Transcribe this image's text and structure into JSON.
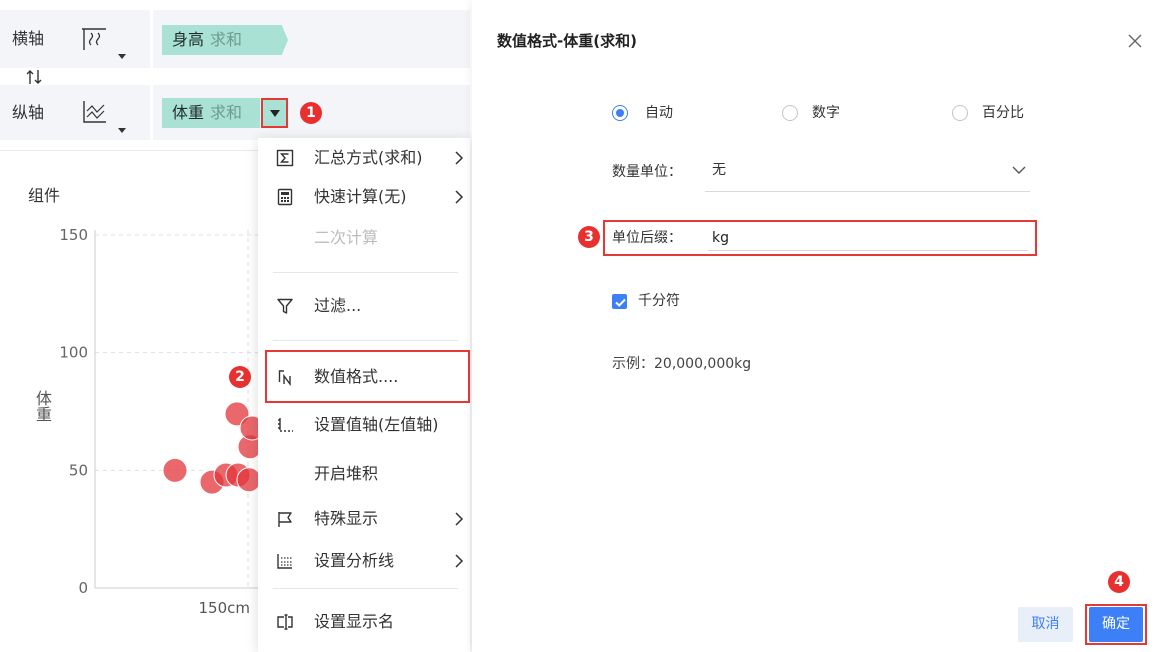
{
  "axes_panel": {
    "x_axis": {
      "label": "横轴",
      "icon": "horizontal-axis-chart-icon",
      "field": {
        "name": "身高",
        "agg": "求和"
      }
    },
    "swap_icon": "swap-axes-icon",
    "y_axis": {
      "label": "纵轴",
      "icon": "vertical-axis-chart-icon",
      "field": {
        "name": "体重",
        "agg": "求和"
      },
      "dropdown_icon": "caret-down-icon"
    }
  },
  "chart_data": {
    "type": "scatter",
    "title": "组件",
    "ylabel": "体重",
    "ylim": [
      0,
      150
    ],
    "y_ticks": [
      0,
      50,
      100,
      150
    ],
    "y_tick_labels": [
      "0",
      "50",
      "100",
      "150"
    ],
    "x_ticks": [
      150
    ],
    "x_tick_labels": [
      "150cm"
    ],
    "grid": true,
    "series": [
      {
        "color": "#e3343b",
        "points": [
          {
            "x": 142.7,
            "y": 50
          },
          {
            "x": 146.4,
            "y": 45
          },
          {
            "x": 147.8,
            "y": 48
          },
          {
            "x": 148.9,
            "y": 74
          },
          {
            "x": 149.0,
            "y": 48
          },
          {
            "x": 150.1,
            "y": 46
          },
          {
            "x": 150.2,
            "y": 60
          },
          {
            "x": 150.4,
            "y": 68
          }
        ]
      }
    ]
  },
  "context_menu": {
    "items": [
      {
        "label": "汇总方式(求和)",
        "icon": "sigma-icon",
        "has_submenu": true,
        "disabled": false
      },
      {
        "label": "快速计算(无)",
        "icon": "calculator-icon",
        "has_submenu": true,
        "disabled": false
      },
      {
        "label": "二次计算",
        "icon": null,
        "has_submenu": false,
        "disabled": true
      },
      {
        "label": "过滤...",
        "icon": "filter-icon",
        "has_submenu": false,
        "disabled": false
      },
      {
        "label": "数值格式....",
        "icon": "number-format-icon",
        "has_submenu": false,
        "disabled": false,
        "highlighted": true
      },
      {
        "label": "设置值轴(左值轴)",
        "icon": "value-axis-icon",
        "has_submenu": false,
        "disabled": false
      },
      {
        "label": "开启堆积",
        "icon": null,
        "has_submenu": false,
        "disabled": false
      },
      {
        "label": "特殊显示",
        "icon": "flag-icon",
        "has_submenu": true,
        "disabled": false
      },
      {
        "label": "设置分析线",
        "icon": "analysis-line-icon",
        "has_submenu": true,
        "disabled": false
      },
      {
        "label": "设置显示名",
        "icon": "rename-icon",
        "has_submenu": false,
        "disabled": false
      }
    ]
  },
  "dialog": {
    "title": "数值格式-体重(求和)",
    "close_icon": "close-icon",
    "format_type": {
      "options": [
        "自动",
        "数字",
        "百分比"
      ],
      "selected": "自动"
    },
    "unit": {
      "label": "数量单位：",
      "value": "无"
    },
    "suffix": {
      "label": "单位后缀：",
      "value": "kg"
    },
    "thousands_separator": {
      "label": "千分符",
      "checked": true
    },
    "example": "示例：20,000,000kg",
    "buttons": {
      "cancel": "取消",
      "confirm": "确定"
    }
  },
  "step_badges": [
    "1",
    "2",
    "3",
    "4"
  ],
  "colors": {
    "accent": "#3d7ff6",
    "badge": "#e8312f",
    "highlight_border": "#e53935",
    "field_pill": "#a9e2d5",
    "point": "#e3343b"
  }
}
